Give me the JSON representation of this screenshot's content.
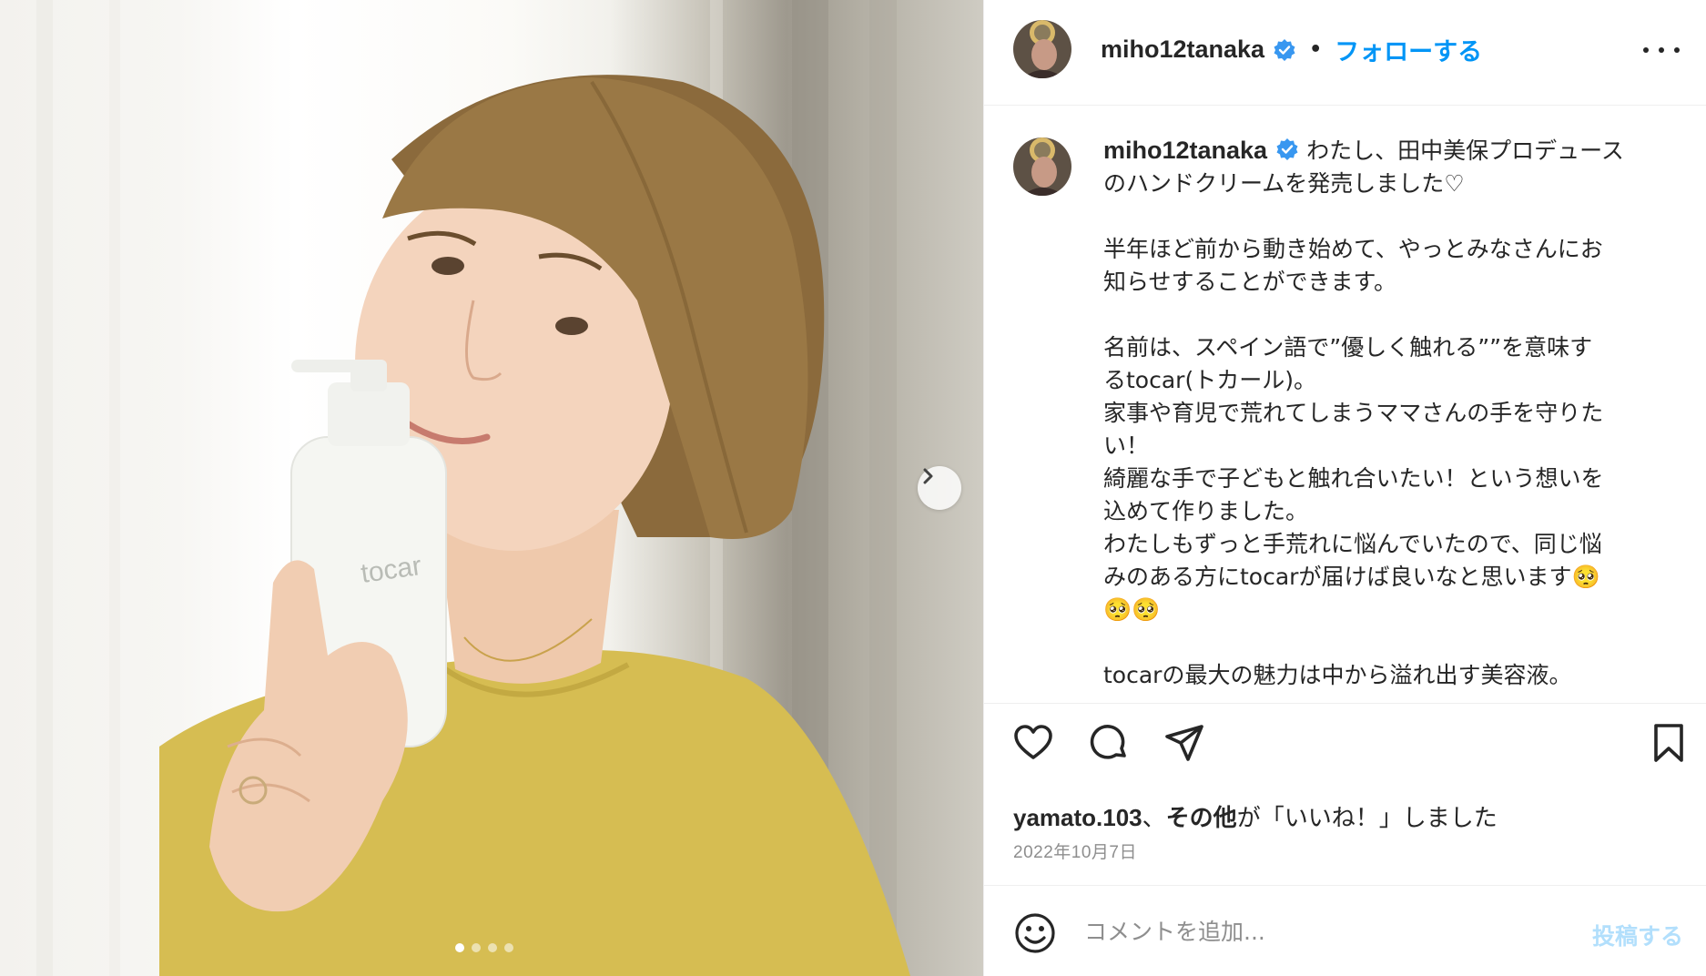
{
  "media": {
    "product_label": "tocar",
    "carousel_total": 4,
    "carousel_active_index": 0
  },
  "header": {
    "username": "miho12tanaka",
    "separator": "•",
    "follow_label": "フォローする"
  },
  "caption": {
    "username": "miho12tanaka",
    "lines": [
      "わたし、田中美保プロデュース",
      "のハンドクリームを発売しました♡",
      "",
      "半年ほど前から動き始めて、やっとみなさんにお",
      "知らせすることができます。",
      "",
      "名前は、スペイン語で”優しく触れる””を意味す",
      "るtocar(トカール)。",
      "家事や育児で荒れてしまうママさんの手を守りた",
      "い！",
      "綺麗な手で子どもと触れ合いたい！という想いを",
      "込めて作りました。",
      "わたしもずっと手荒れに悩んでいたので、同じ悩",
      "みのある方にtocarが届けば良いなと思います🥺",
      "🥺🥺",
      "",
      "tocarの最大の魅力は中から溢れ出す美容液。"
    ]
  },
  "likes": {
    "user": "yamato.103",
    "separator": "、",
    "others": "その他",
    "suffix": "が「いいね！」しました"
  },
  "date": "2022年10月7日",
  "comment": {
    "placeholder": "コメントを追加...",
    "post_label": "投稿する"
  }
}
